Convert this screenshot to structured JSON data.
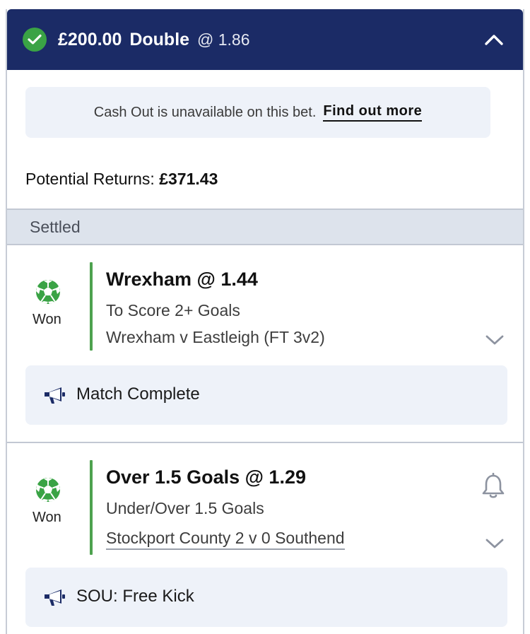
{
  "header": {
    "stake": "£200.00",
    "bet_type": "Double",
    "odds": "@ 1.86"
  },
  "cashout": {
    "message": "Cash Out is unavailable on this bet.",
    "link": "Find out more"
  },
  "returns": {
    "label": "Potential Returns:",
    "amount": "£371.43"
  },
  "section": {
    "label": "Settled"
  },
  "legs": [
    {
      "status": "Won",
      "selection": "Wrexham @ 1.44",
      "market": "To Score 2+ Goals",
      "event": "Wrexham v Eastleigh (FT 3v2)",
      "update": "Match Complete"
    },
    {
      "status": "Won",
      "selection": "Over 1.5 Goals @ 1.29",
      "market": "Under/Over 1.5 Goals",
      "event": "Stockport County 2 v 0 Southend",
      "update": "SOU: Free Kick"
    }
  ],
  "colors": {
    "header_bg": "#1b2b66",
    "won_green": "#3aa345",
    "panel_bg": "#eef2f9"
  }
}
